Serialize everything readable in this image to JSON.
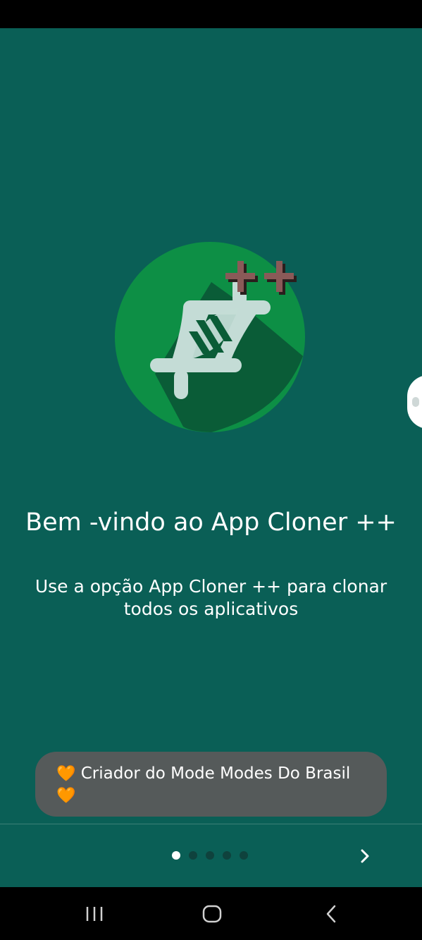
{
  "app": {
    "name": "App Cloner ++"
  },
  "onboarding": {
    "title": "Bem -vindo ao App Cloner ++",
    "description": "Use a opção App Cloner ++ para clonar todos os aplicativos",
    "logo_icon": "app-cloner-dna-logo",
    "logo_badge": "++",
    "pager": {
      "total_pages": 5,
      "current_page": 1
    },
    "next_icon": "chevron-right-icon"
  },
  "toast": {
    "text": "Criador do Mode Modes Do Brasil",
    "icon": "orange-heart"
  },
  "navigation_bar": {
    "recents_icon": "recents-icon",
    "home_icon": "home-icon",
    "back_icon": "back-icon"
  },
  "colors": {
    "background": "#0a5f56",
    "logo_circle": "#0d8f45",
    "logo_shadow": "#0a5c37",
    "dna": "#c4dcd6",
    "badge_plus": "#8a5a58",
    "toast_bg": "#555a5a",
    "dot_active": "#ffffff",
    "dot_inactive": "#0f423d",
    "heart": "#f08a3c"
  }
}
